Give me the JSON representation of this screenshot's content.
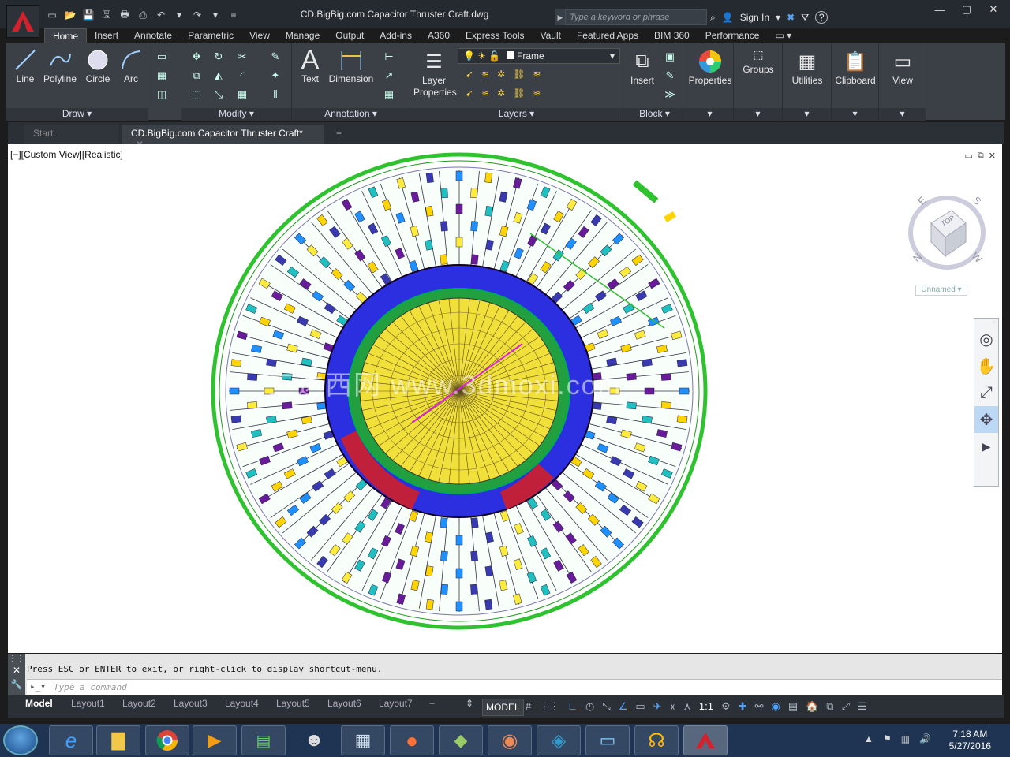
{
  "window": {
    "title": "CD.BigBig.com Capacitor Thruster Craft.dwg",
    "search_placeholder": "Type a keyword or phrase",
    "sign_in": "Sign In",
    "help": "?"
  },
  "ribbon_tabs": [
    "Home",
    "Insert",
    "Annotate",
    "Parametric",
    "View",
    "Manage",
    "Output",
    "Add-ins",
    "A360",
    "Express Tools",
    "Vault",
    "Featured Apps",
    "BIM 360",
    "Performance"
  ],
  "ribbon": {
    "draw": {
      "label": "Draw",
      "line": "Line",
      "polyline": "Polyline",
      "circle": "Circle",
      "arc": "Arc"
    },
    "modify": {
      "label": "Modify"
    },
    "annotation": {
      "label": "Annotation",
      "text": "Text",
      "dimension": "Dimension"
    },
    "layers": {
      "label": "Layers",
      "layer_properties": "Layer Properties",
      "current_layer": "Frame"
    },
    "block": {
      "label": "Block",
      "insert": "Insert"
    },
    "properties": "Properties",
    "groups": "Groups",
    "utilities": "Utilities",
    "clipboard": "Clipboard",
    "view": "View"
  },
  "doc_tabs": {
    "start": "Start",
    "active": "CD.BigBig.com Capacitor Thruster Craft*",
    "plus": "+"
  },
  "viewport": {
    "label": "[−][Custom View][Realistic]",
    "watermark": "三达西网 www.3dmoxi.com",
    "viewcube_face": "TOP",
    "compass": {
      "n": "N",
      "e": "E",
      "s": "S",
      "w": "W"
    },
    "view_name": "Unnamed"
  },
  "command": {
    "history": "Press ESC or ENTER to exit, or right-click to display shortcut-menu.",
    "placeholder": "Type a command"
  },
  "layout_tabs": [
    "Model",
    "Layout1",
    "Layout2",
    "Layout3",
    "Layout4",
    "Layout5",
    "Layout6",
    "Layout7"
  ],
  "status": {
    "model": "MODEL",
    "scale": "1:1"
  },
  "clock": {
    "time": "7:18 AM",
    "date": "5/27/2016"
  }
}
